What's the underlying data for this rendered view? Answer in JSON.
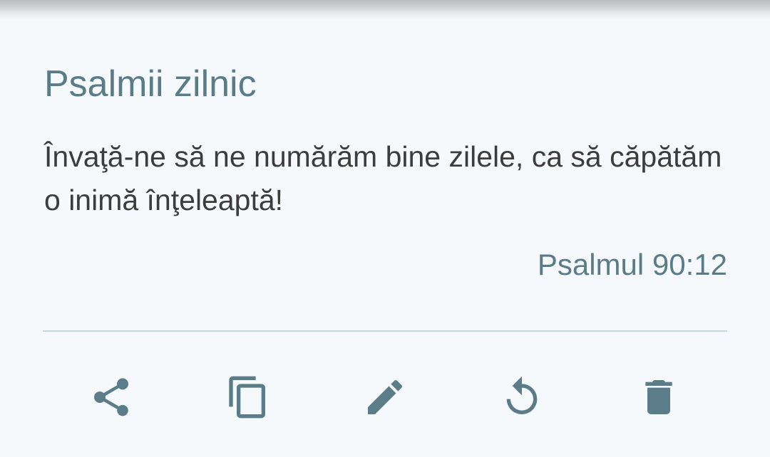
{
  "card": {
    "title": "Psalmii zilnic",
    "quote": "Învaţă-ne să ne numărăm bine zilele, ca să căpătăm o inimă înţeleaptă!",
    "reference": "Psalmul 90:12"
  },
  "actions": [
    {
      "name": "share",
      "icon": "share-icon"
    },
    {
      "name": "copy",
      "icon": "copy-icon"
    },
    {
      "name": "edit",
      "icon": "pencil-icon"
    },
    {
      "name": "reset",
      "icon": "refresh-icon"
    },
    {
      "name": "delete",
      "icon": "trash-icon"
    }
  ],
  "colors": {
    "background": "#f5f9fc",
    "accent": "#5a7c89",
    "text": "#3c3c3c",
    "divider": "#c5d9dd"
  }
}
